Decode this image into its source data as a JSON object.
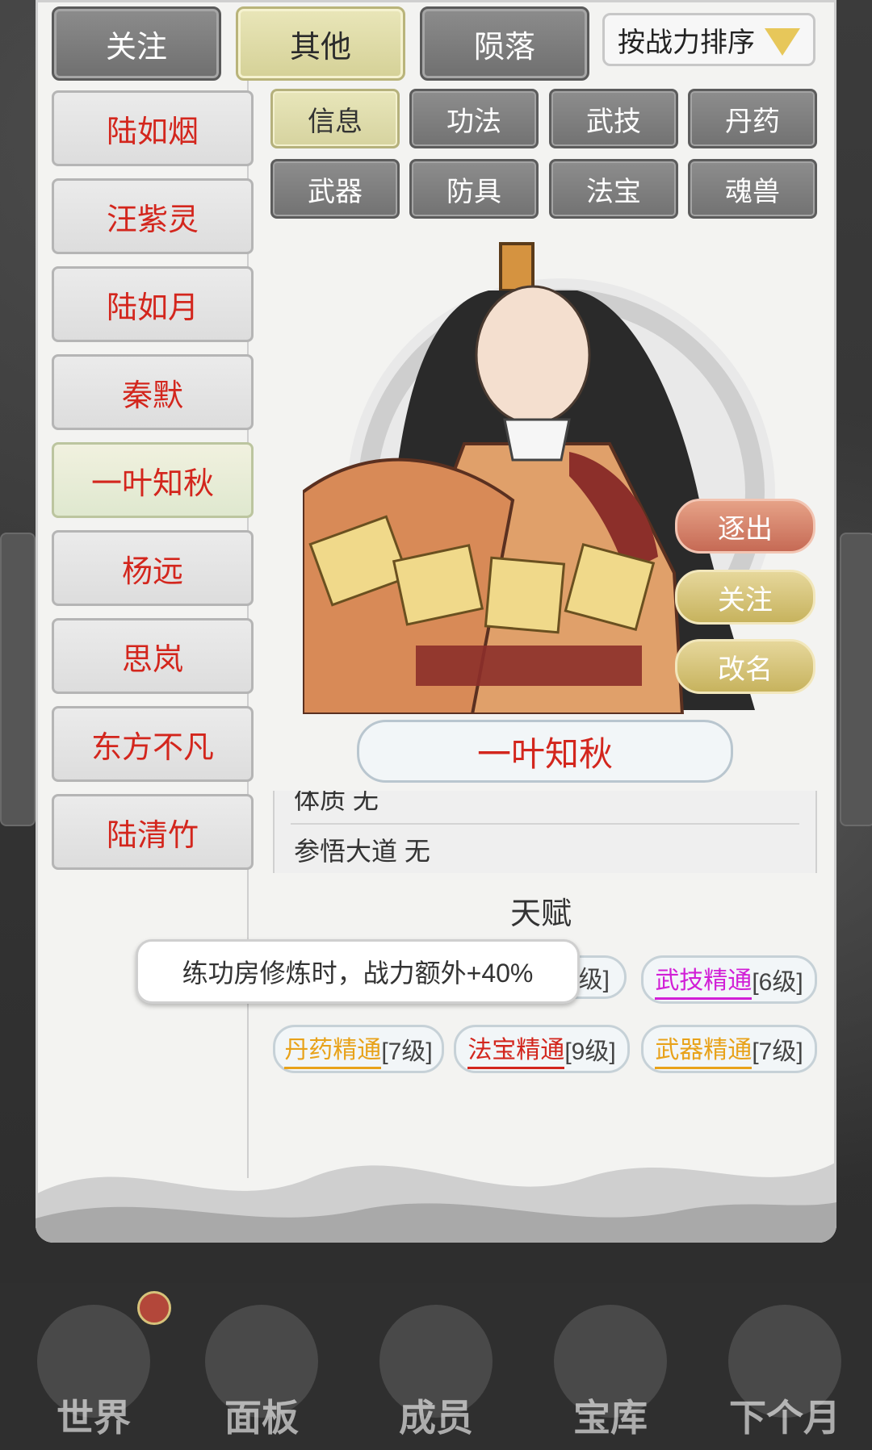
{
  "top_tabs": [
    {
      "label": "关注",
      "active": false
    },
    {
      "label": "其他",
      "active": true
    },
    {
      "label": "陨落",
      "active": false
    }
  ],
  "sort": {
    "label": "按战力排序"
  },
  "members": [
    {
      "name": "陆如烟",
      "selected": false
    },
    {
      "name": "汪紫灵",
      "selected": false
    },
    {
      "name": "陆如月",
      "selected": false
    },
    {
      "name": "秦默",
      "selected": false
    },
    {
      "name": "一叶知秋",
      "selected": true
    },
    {
      "name": "杨远",
      "selected": false
    },
    {
      "name": "思岚",
      "selected": false
    },
    {
      "name": "东方不凡",
      "selected": false
    },
    {
      "name": "陆清竹",
      "selected": false
    }
  ],
  "sub_tabs": [
    {
      "label": "信息",
      "active": true
    },
    {
      "label": "功法",
      "active": false
    },
    {
      "label": "武技",
      "active": false
    },
    {
      "label": "丹药",
      "active": false
    },
    {
      "label": "武器",
      "active": false
    },
    {
      "label": "防具",
      "active": false
    },
    {
      "label": "法宝",
      "active": false
    },
    {
      "label": "魂兽",
      "active": false
    }
  ],
  "character": {
    "name": "一叶知秋",
    "actions": {
      "expel": "逐出",
      "follow": "关注",
      "rename": "改名"
    }
  },
  "info": {
    "rows": [
      {
        "label": "体质",
        "value": "无"
      },
      {
        "label": "参悟大道",
        "value": "无"
      }
    ]
  },
  "talent": {
    "header": "天赋",
    "tooltip": "练功房修炼时，战力额外+40%",
    "chips": [
      {
        "name": "武技精通",
        "level": "[6级]",
        "color": "#d11fd6"
      },
      {
        "name": "丹药精通",
        "level": "[7级]",
        "color": "#e8a21a"
      },
      {
        "name": "法宝精通",
        "level": "[9级]",
        "color": "#d3261d"
      },
      {
        "name": "武器精通",
        "level": "[7级]",
        "color": "#e8a21a"
      }
    ],
    "partial_chip_suffix": "级]"
  },
  "nav": [
    {
      "label": "世界",
      "icon": "world-icon"
    },
    {
      "label": "面板",
      "icon": "panel-icon"
    },
    {
      "label": "成员",
      "icon": "members-icon"
    },
    {
      "label": "宝库",
      "icon": "treasury-icon"
    },
    {
      "label": "下个月",
      "icon": "next-month-icon"
    }
  ],
  "colors": {
    "red_text": "#d3261d",
    "tab_active": "#e4e1b4",
    "tab_inactive": "#7f7f7f"
  }
}
